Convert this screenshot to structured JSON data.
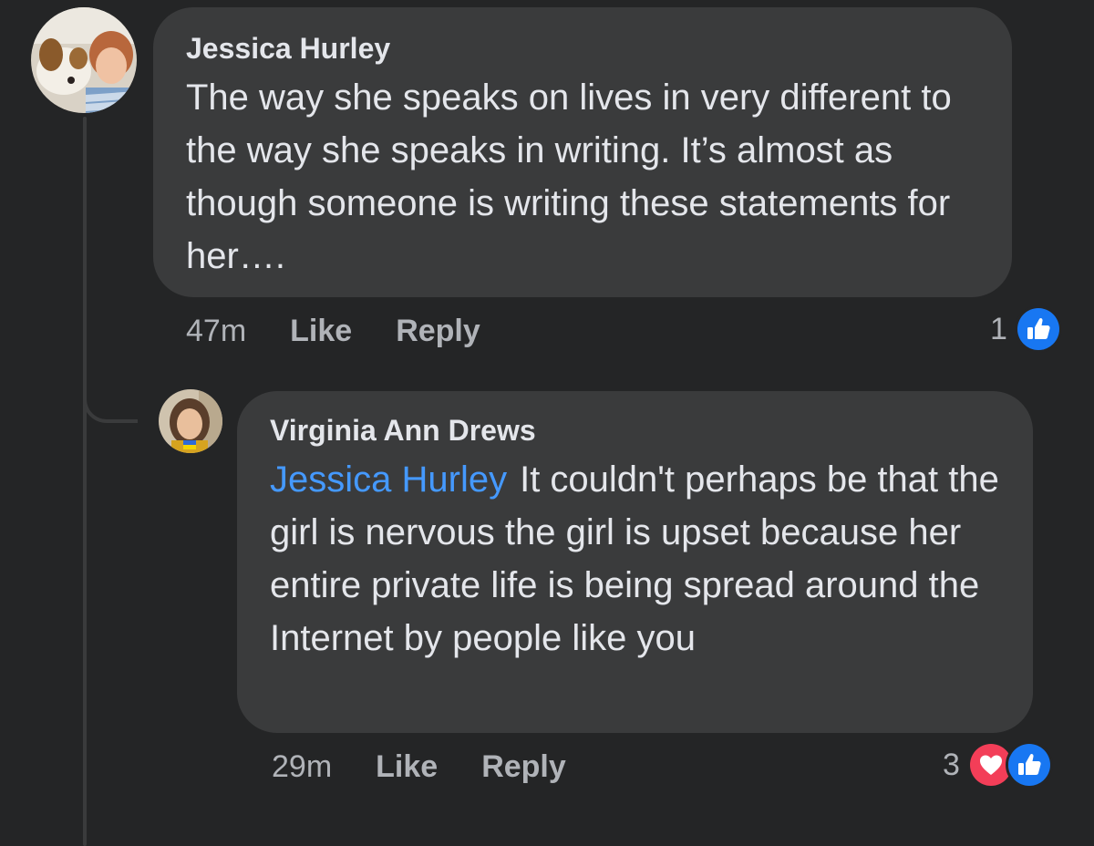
{
  "comments": [
    {
      "author": "Jessica Hurley",
      "text": "The way she speaks on lives in very different to the way she speaks in writing. It’s almost as though someone is writing these statements for her….",
      "time": "47m",
      "like_label": "Like",
      "reply_label": "Reply",
      "reaction_count": "1",
      "reactions": [
        "like-icon"
      ]
    },
    {
      "author": "Virginia Ann Drews",
      "mention": "Jessica Hurley",
      "text": "It couldn't perhaps be that the girl is nervous the girl is upset because her entire private life is being spread around the Internet by people like you",
      "time": "29m",
      "like_label": "Like",
      "reply_label": "Reply",
      "reaction_count": "3",
      "reactions": [
        "love-icon",
        "like-icon"
      ]
    }
  ],
  "colors": {
    "background": "#242526",
    "bubble": "#3a3b3c",
    "text": "#e4e6eb",
    "secondary_text": "#b0b3b8",
    "mention": "#4599ff",
    "like_blue": "#1877f2",
    "love_red": "#f33e58"
  }
}
